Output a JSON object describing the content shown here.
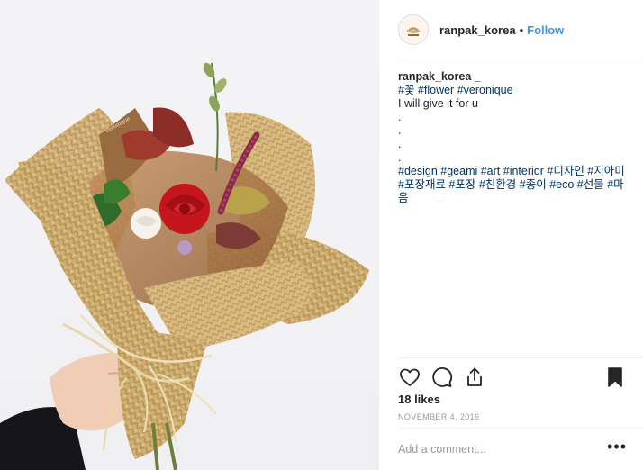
{
  "post": {
    "username": "ranpak_korea",
    "separator": "•",
    "follow_label": "Follow"
  },
  "caption": {
    "author": "ranpak_korea _",
    "tags_line1": "#꽃 #flower #veronique",
    "text": "I will give it for u",
    "dots": [
      ".",
      ".",
      ".",
      "."
    ],
    "tags_line2": "#design #geami #art #interior #디자인 #지아미 #포장재료 #포장 #친환경 #종이 #eco #선물 #마음"
  },
  "actions": {
    "icons": [
      "heart-icon",
      "comment-icon",
      "share-icon",
      "bookmark-icon"
    ]
  },
  "likes": "18 likes",
  "date": "NOVEMBER 4, 2016",
  "comment": {
    "placeholder": "Add a comment...",
    "more_label": "•••"
  },
  "colors": {
    "link_blue": "#3897f0",
    "hashtag": "#003569",
    "text": "#262626",
    "muted": "#999999",
    "kraft_paper": "#c9a76a",
    "rose": "#c4161c"
  }
}
